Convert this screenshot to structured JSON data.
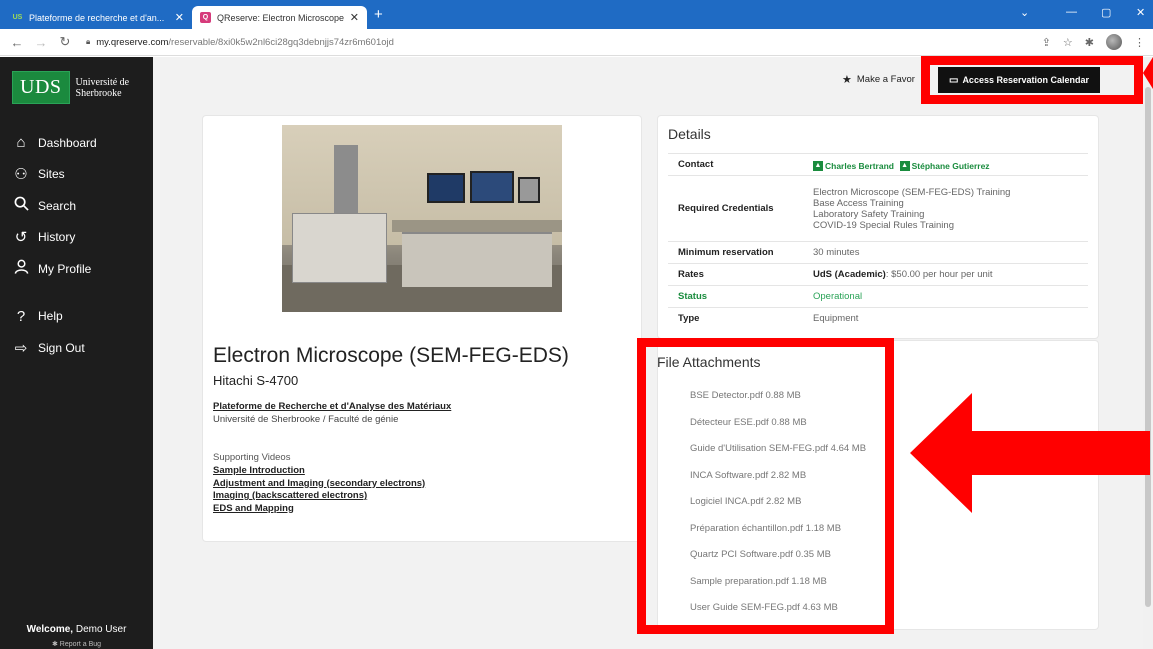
{
  "browser": {
    "tabs": [
      {
        "label": "Plateforme de recherche et d'an...",
        "favicon": "US"
      },
      {
        "label": "QReserve: Electron Microscope (...",
        "favicon": "Q"
      }
    ],
    "url_host": "my.qreserve.com",
    "url_path": "/reservable/8xi0k5w2nl6ci28gq3debnjjs74zr6m601ojd"
  },
  "sidebar": {
    "logo_mark": "UDS",
    "logo_line1": "Université de",
    "logo_line2": "Sherbrooke",
    "items": [
      {
        "label": "Dashboard",
        "icon": "home-icon"
      },
      {
        "label": "Sites",
        "icon": "sites-icon"
      },
      {
        "label": "Search",
        "icon": "search-icon"
      },
      {
        "label": "History",
        "icon": "history-icon"
      },
      {
        "label": "My Profile",
        "icon": "profile-icon"
      },
      {
        "label": "Help",
        "icon": "help-icon"
      },
      {
        "label": "Sign Out",
        "icon": "sign-out-icon"
      }
    ],
    "welcome_prefix": "Welcome,",
    "welcome_user": "Demo User",
    "report_bug": "Report a Bug"
  },
  "actions": {
    "favorite": "Make a Favor",
    "calendar": "Access Reservation Calendar"
  },
  "resource": {
    "title": "Electron Microscope (SEM-FEG-EDS)",
    "model": "Hitachi S-4700",
    "platform": "Plateforme de Recherche et d'Analyse des Matériaux",
    "affiliation": "Université de Sherbrooke / Faculté de génie",
    "videos_heading": "Supporting Videos",
    "videos": [
      "Sample Introduction",
      "Adjustment and Imaging (secondary electrons)",
      "Imaging (backscattered electrons)",
      "EDS and Mapping"
    ]
  },
  "details": {
    "heading": "Details",
    "contact_label": "Contact",
    "contacts": [
      "Charles Bertrand",
      "Stéphane Gutierrez"
    ],
    "credentials_label": "Required Credentials",
    "credentials": [
      "Electron Microscope (SEM-FEG-EDS) Training",
      "Base Access Training",
      "Laboratory Safety Training",
      "COVID-19 Special Rules Training"
    ],
    "min_label": "Minimum reservation",
    "min_value": "30 minutes",
    "rates_label": "Rates",
    "rates_tier": "UdS (Academic)",
    "rates_value": ": $50.00 per hour per unit",
    "status_label": "Status",
    "status_value": "Operational",
    "type_label": "Type",
    "type_value": "Equipment"
  },
  "attachments": {
    "heading": "File Attachments",
    "files": [
      "BSE Detector.pdf 0.88 MB",
      "Détecteur ESE.pdf 0.88 MB",
      "Guide d'Utilisation SEM-FEG.pdf 4.64 MB",
      "INCA Software.pdf 2.82 MB",
      "Logiciel INCA.pdf 2.82 MB",
      "Préparation échantillon.pdf 1.18 MB",
      "Quartz PCI Software.pdf 0.35 MB",
      "Sample preparation.pdf 1.18 MB",
      "User Guide SEM-FEG.pdf 4.63 MB"
    ]
  },
  "colors": {
    "annotation": "#ff0000",
    "brand_green": "#1b8a3e",
    "sidebar_bg": "#1d1d1d",
    "browser_blue": "#1f6bc4"
  }
}
